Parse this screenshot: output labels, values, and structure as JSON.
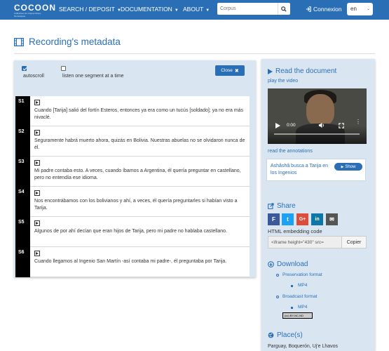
{
  "navbar": {
    "logo_text": "COCOON",
    "logo_sub": "Collections de Corpus Oraux Numériques",
    "items": [
      {
        "label": "SEARCH / DEPOSIT"
      },
      {
        "label": "DOCUMENTATION"
      },
      {
        "label": "ABOUT"
      }
    ],
    "search_placeholder": "Corpus",
    "login_label": "Connexion",
    "lang": "en",
    "icons": {
      "search": "search-icon",
      "login": "login-icon",
      "caret": "caret-down-icon"
    }
  },
  "page": {
    "title": "Recording's metadata",
    "title_icon": "film-icon"
  },
  "controls": {
    "autoscroll_label": "autoscroll",
    "autoscroll_checked": true,
    "segment_label": "listen one segment at a time",
    "segment_checked": false,
    "close_label": "Close"
  },
  "segments": [
    {
      "id": "S1",
      "text": "Cuando [Tarija] salió del fortín Esteros, entonces ya era como un tucús [soldado]; ya no era más nivaclé."
    },
    {
      "id": "S2",
      "text": "Seguramente habrá muerto ahora, quizás en Bolivia. Nuestras abuelas no se olvidaron nunca de él."
    },
    {
      "id": "S3",
      "text": "Mi padre contaba esto. A veces, cuando íbamos a Argentina, él quería preguntar en castellano, pero no entendía ese idioma."
    },
    {
      "id": "S4",
      "text": "Nos encontrábamos con los bolivianos y ahí, a veces, él quería preguntarles si habían visto a Tarija."
    },
    {
      "id": "S5",
      "text": "Algunos de por ahí decían que eran hijos de Tarija, pero mi padre no hablaba castellano."
    },
    {
      "id": "S6",
      "text": "Cuando llegamos al Ingenio San Martín -así contaba mi padre-, él preguntaba por Tarija."
    }
  ],
  "right": {
    "read_doc": "Read the document",
    "play_video": "play the video",
    "video_time": "0:00",
    "read_annotations": "read the annotations",
    "annotation_title": "Ashâshâ busca a Tarija en los Ingenios",
    "show_label": "Show",
    "share": "Share",
    "social": [
      "F",
      "t",
      "G+",
      "in",
      "✉"
    ],
    "embed_label": "HTML embedding code",
    "embed_code": "<iframe height=\"430\" src=",
    "copy_label": "Copier",
    "download": "Download",
    "preservation": "Preservation format",
    "mp4_a": "MP4",
    "broadcast": "Broadcast format",
    "mp4_b": "MP4",
    "cc": "(cc) BY-NC-ND",
    "places_head": "Place(s)",
    "places": "Parguay, Boquerón, Uj'e Lhavos"
  }
}
